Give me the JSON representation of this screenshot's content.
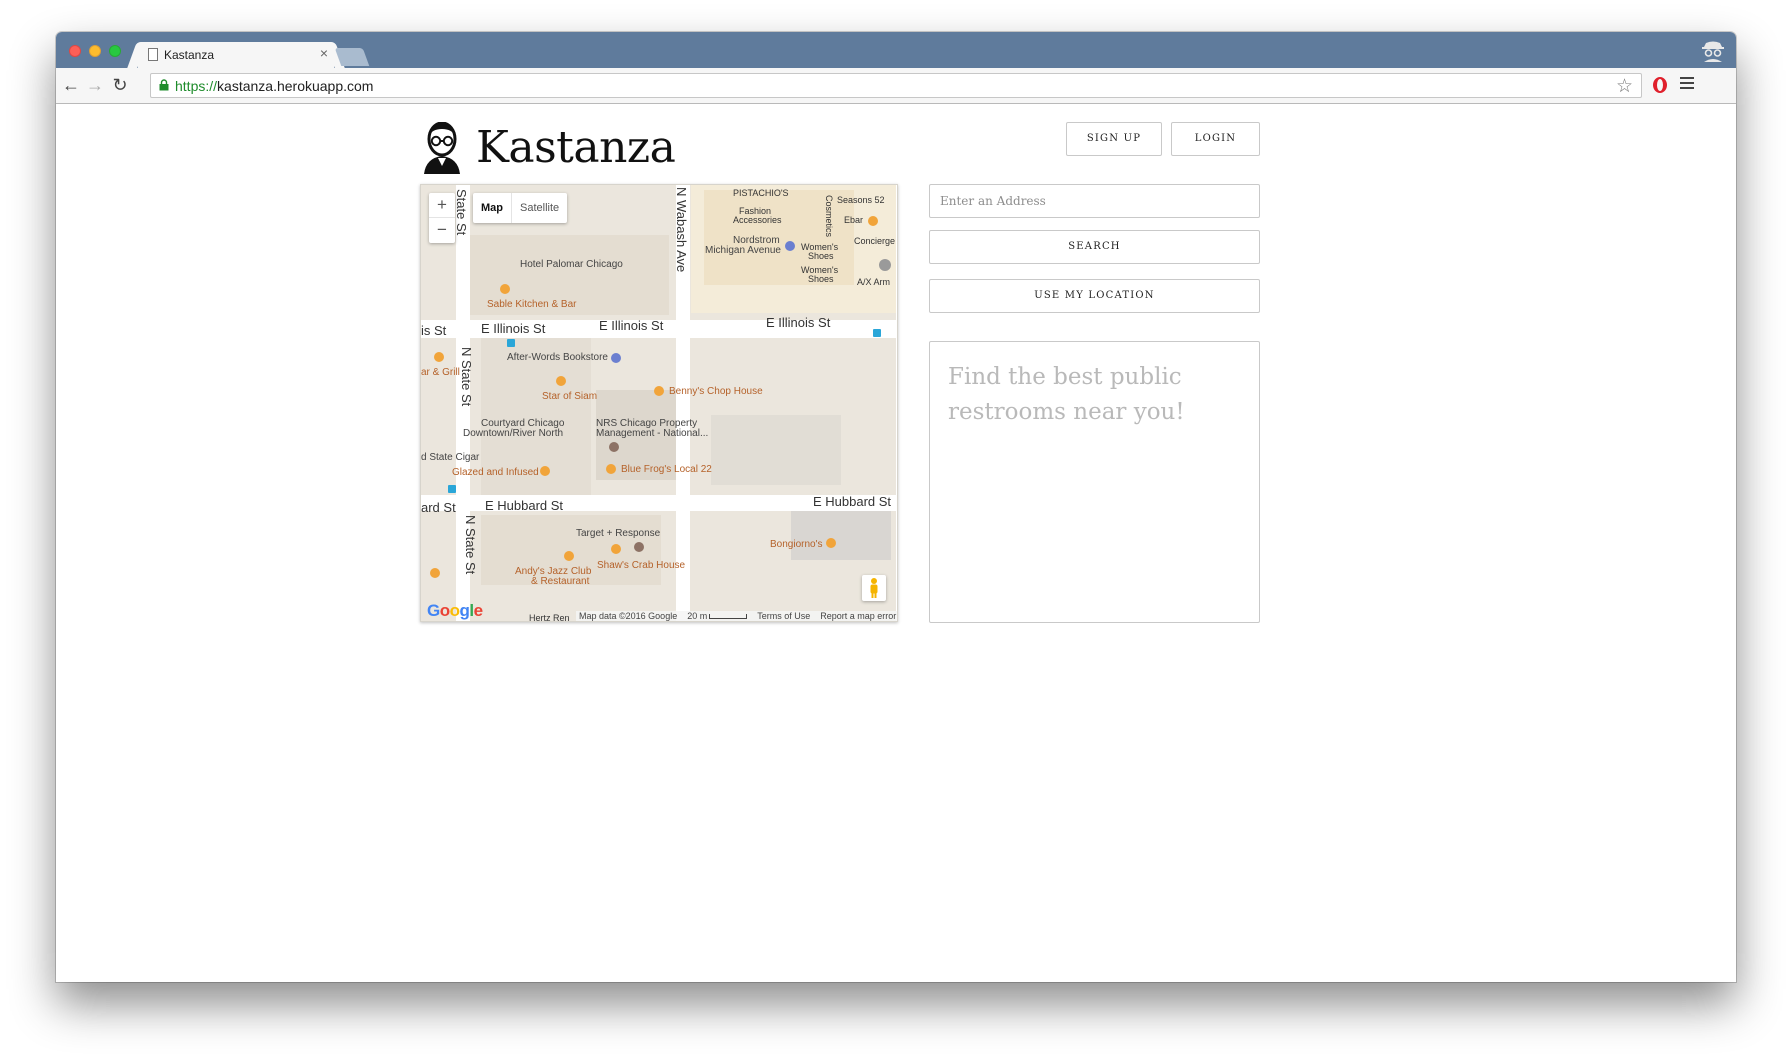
{
  "browser": {
    "tab_title": "Kastanza",
    "tab_close": "×",
    "url_scheme": "https://",
    "url_host": "kastanza.herokuapp.com",
    "back": "←",
    "forward": "→",
    "reload": "↻",
    "bookmark": "☆"
  },
  "header": {
    "brand": "Kastanza",
    "signup_label": "SIGN UP",
    "login_label": "LOGIN"
  },
  "search": {
    "address_placeholder": "Enter an Address",
    "search_label": "SEARCH",
    "location_label": "USE MY LOCATION"
  },
  "results": {
    "prompt": "Find the best public restrooms near you!"
  },
  "map": {
    "zoom_in": "+",
    "zoom_out": "−",
    "type_map": "Map",
    "type_satellite": "Satellite",
    "google_letters": [
      "G",
      "o",
      "o",
      "g",
      "l",
      "e"
    ],
    "attribution": "Map data ©2016 Google",
    "scale": "20 m",
    "terms": "Terms of Use",
    "report": "Report a map error",
    "streets": {
      "illinois_1": "E Illinois St",
      "illinois_2": "E Illinois St",
      "illinois_3": "E Illinois St",
      "hubbard_1": "E Hubbard St",
      "hubbard_2": "E Hubbard St",
      "state_top": "State St",
      "state_mid": "N State St",
      "state_bot": "N State St",
      "wabash": "N Wabash Ave",
      "is_st": "is St",
      "rd_st": "ard St"
    },
    "places": {
      "hotel_palomar": "Hotel Palomar Chicago",
      "sable": "Sable Kitchen & Bar",
      "afterwords": "After-Words Bookstore",
      "star_siam": "Star of Siam",
      "bennys": "Benny's Chop House",
      "courtyard_1": "Courtyard Chicago",
      "courtyard_2": "Downtown/River North",
      "nrs_1": "NRS Chicago Property",
      "nrs_2": "Management - National...",
      "state_cigar": "d State Cigar",
      "glazed": "Glazed and Infused",
      "blue_frog": "Blue Frog's Local 22",
      "bar_grill": "ar & Grill",
      "target": "Target + Response",
      "shaws": "Shaw's Crab House",
      "andys_1": "Andy's Jazz Club",
      "andys_2": "& Restaurant",
      "bongiornos": "Bongiorno's",
      "pistachios": "PISTACHIO'S",
      "seasons": "Seasons 52",
      "fashion_1": "Fashion",
      "fashion_2": "Accessories",
      "cosmetics": "Cosmetics",
      "ebar": "Ebar",
      "nordstrom_1": "Nordstrom",
      "nordstrom_2": "Michigan Avenue",
      "womens_1a": "Women's",
      "womens_1b": "Shoes",
      "womens_2a": "Women's",
      "womens_2b": "Shoes",
      "concierge": "Concierge",
      "ax_arm": "A/X Arm",
      "hertz": "Hertz Ren"
    }
  }
}
